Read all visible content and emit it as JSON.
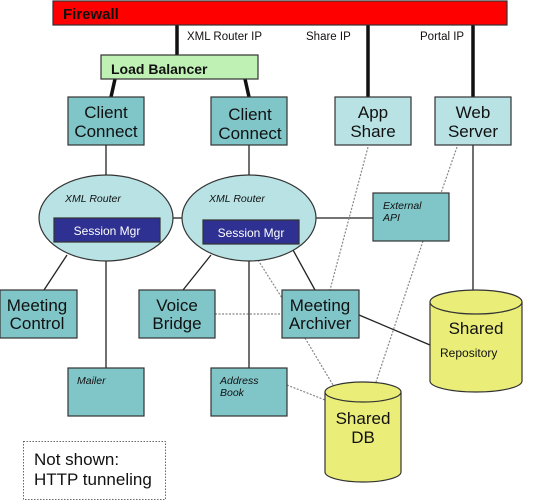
{
  "colors": {
    "firewall": "#ff0000",
    "load_balancer": "#bff0b4",
    "component_dark": "#80c5c8",
    "component_light": "#b8e2e4",
    "session_mgr": "#2e3192",
    "storage": "#eaee78"
  },
  "firewall": {
    "label": "Firewall"
  },
  "ip_labels": {
    "xml_router": "XML Router IP",
    "share": "Share IP",
    "portal": "Portal IP"
  },
  "load_balancer": {
    "label": "Load Balancer"
  },
  "client_connect_1": {
    "line1": "Client",
    "line2": "Connect"
  },
  "client_connect_2": {
    "line1": "Client",
    "line2": "Connect"
  },
  "app_share": {
    "line1": "App",
    "line2": "Share"
  },
  "web_server": {
    "line1": "Web",
    "line2": "Server"
  },
  "xml_router_1": {
    "label": "XML Router",
    "session": "Session Mgr"
  },
  "xml_router_2": {
    "label": "XML Router",
    "session": "Session Mgr"
  },
  "external_api": {
    "line1": "External",
    "line2": "API"
  },
  "meeting_control": {
    "line1": "Meeting",
    "line2": "Control"
  },
  "voice_bridge": {
    "line1": "Voice",
    "line2": "Bridge"
  },
  "meeting_archiver": {
    "line1": "Meeting",
    "line2": "Archiver"
  },
  "mailer": {
    "label": "Mailer"
  },
  "address_book": {
    "line1": "Address",
    "line2": "Book"
  },
  "shared_db": {
    "line1": "Shared",
    "line2": "DB"
  },
  "shared_repository": {
    "line1": "Shared",
    "line2": "Repository"
  },
  "note": {
    "line1": "Not shown:",
    "line2": "HTTP tunneling"
  }
}
